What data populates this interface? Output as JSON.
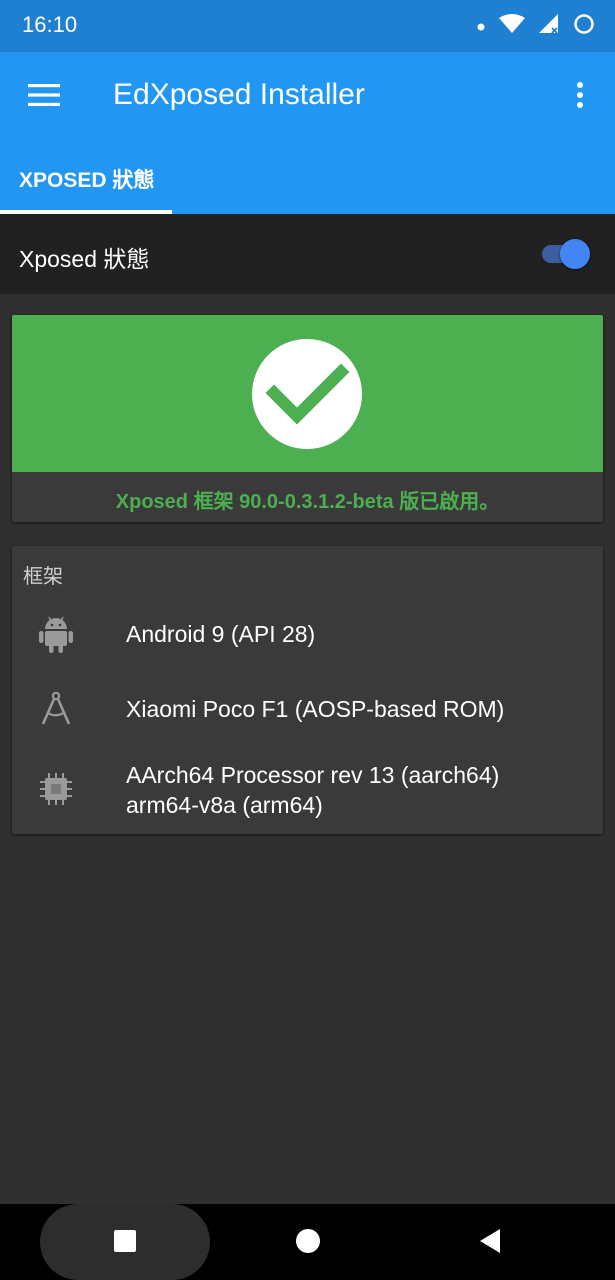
{
  "status_bar": {
    "time": "16:10",
    "icons": [
      "notification-dot-icon",
      "wifi-icon",
      "signal-icon",
      "battery-icon"
    ]
  },
  "app_bar": {
    "title": "EdXposed Installer",
    "menu_icon": "hamburger-menu-icon",
    "overflow_icon": "more-vert-icon",
    "tabs": [
      {
        "label": "XPOSED 狀態",
        "selected": true
      }
    ]
  },
  "toggle_row": {
    "label": "Xposed 狀態",
    "enabled": true
  },
  "status_card": {
    "icon": "checkmark-icon",
    "message": "Xposed 框架 90.0-0.3.1.2-beta 版已啟用。"
  },
  "framework_card": {
    "heading": "框架",
    "rows": [
      {
        "icon": "android-icon",
        "text": "Android  9 (API 28)"
      },
      {
        "icon": "compass-icon",
        "text": "Xiaomi Poco F1 (AOSP-based ROM)"
      },
      {
        "icon": "cpu-chip-icon",
        "text": "AArch64 Processor rev 13 (aarch64)",
        "text2": "arm64-v8a (arm64)"
      }
    ]
  },
  "nav_bar": {
    "buttons": [
      "recents-square-icon",
      "home-circle-icon",
      "back-triangle-icon"
    ]
  },
  "colors": {
    "status_bar": "#1f7fd1",
    "app_bar": "#2196f3",
    "success": "#4caf50",
    "background": "#303030",
    "card": "#3a3a3a"
  }
}
